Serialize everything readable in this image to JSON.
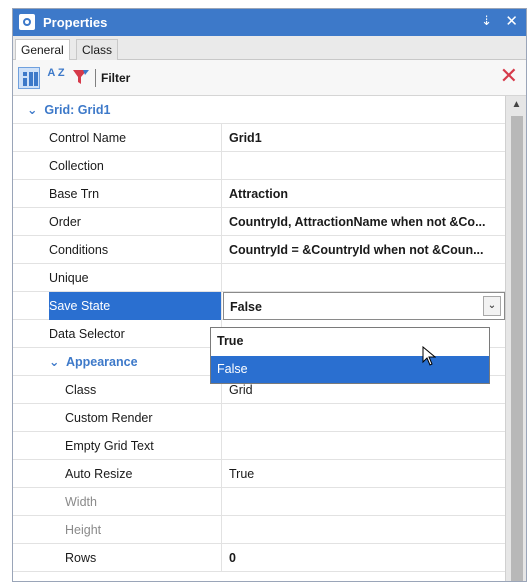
{
  "window": {
    "title": "Properties"
  },
  "tabs": [
    {
      "label": "General"
    },
    {
      "label": "Class"
    }
  ],
  "toolbar": {
    "az_label": "A Z",
    "filter_label": "Filter",
    "filter_value": ""
  },
  "category": {
    "label": "Grid: Grid1"
  },
  "rows": [
    {
      "name": "Control Name",
      "value": "Grid1"
    },
    {
      "name": "Collection",
      "value": ""
    },
    {
      "name": "Base Trn",
      "value": "Attraction"
    },
    {
      "name": "Order",
      "value": "CountryId, AttractionName when not &Co..."
    },
    {
      "name": "Conditions",
      "value": "CountryId = &CountryId when not &Coun..."
    },
    {
      "name": "Unique",
      "value": ""
    },
    {
      "name": "Save State",
      "value": "False"
    },
    {
      "name": "Data Selector",
      "value": ""
    }
  ],
  "appearance": {
    "label": "Appearance",
    "rows": [
      {
        "name": "Class",
        "value": "Grid"
      },
      {
        "name": "Custom Render",
        "value": ""
      },
      {
        "name": "Empty Grid Text",
        "value": ""
      },
      {
        "name": "Auto Resize",
        "value": "True"
      },
      {
        "name": "Width",
        "value": ""
      },
      {
        "name": "Height",
        "value": ""
      },
      {
        "name": "Rows",
        "value": "0"
      }
    ]
  },
  "dropdown": {
    "options": [
      "True",
      "False"
    ],
    "selected": "False"
  },
  "colors": {
    "accent": "#3d79c9",
    "selection": "#2a6fd0",
    "clear": "#d63a4a"
  }
}
